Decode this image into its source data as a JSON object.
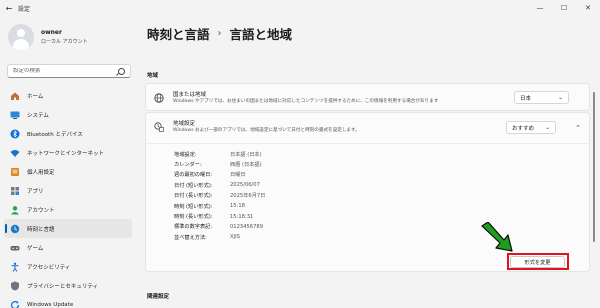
{
  "window": {
    "title": "設定"
  },
  "profile": {
    "name": "owner",
    "account_type": "ローカル アカウント"
  },
  "search": {
    "placeholder": "設定の検索"
  },
  "sidebar": {
    "items": [
      {
        "label": "ホーム",
        "icon": "home-icon"
      },
      {
        "label": "システム",
        "icon": "monitor-icon"
      },
      {
        "label": "Bluetooth とデバイス",
        "icon": "bluetooth-icon"
      },
      {
        "label": "ネットワークとインターネット",
        "icon": "wifi-icon"
      },
      {
        "label": "個人用設定",
        "icon": "brush-icon"
      },
      {
        "label": "アプリ",
        "icon": "apps-icon"
      },
      {
        "label": "アカウント",
        "icon": "person-icon"
      },
      {
        "label": "時刻と言語",
        "icon": "clock-globe-icon",
        "active": true
      },
      {
        "label": "ゲーム",
        "icon": "gamepad-icon"
      },
      {
        "label": "アクセシビリティ",
        "icon": "accessibility-icon"
      },
      {
        "label": "プライバシーとセキュリティ",
        "icon": "shield-icon"
      },
      {
        "label": "Windows Update",
        "icon": "update-icon"
      }
    ]
  },
  "breadcrumb": {
    "parent": "時刻と言語",
    "separator": "›",
    "current": "言語と地域"
  },
  "region": {
    "section_title": "地域",
    "country": {
      "title": "国または地域",
      "description": "Windows やアプリでは、お住まいの国または地域に対応したコンテンツを提供するために、この情報を利用する場合があります",
      "value": "日本"
    },
    "format": {
      "title": "地域設定",
      "description": "Windows および一部のアプリでは、地域設定に基づいて日付と時刻の書式を設定します。",
      "value": "おすすめ",
      "rows": [
        {
          "label": "地域設定:",
          "value": "日本語 (日本)"
        },
        {
          "label": "カレンダー:",
          "value": "西暦 (日本語)"
        },
        {
          "label": "週の最初の曜日:",
          "value": "日曜日"
        },
        {
          "label": "日付 (短い形式):",
          "value": "2025/06/07"
        },
        {
          "label": "日付 (長い形式):",
          "value": "2025年6月7日"
        },
        {
          "label": "時刻 (短い形式):",
          "value": "15:18"
        },
        {
          "label": "時刻 (長い形式):",
          "value": "15:18:31"
        },
        {
          "label": "標準の数字表記:",
          "value": "0123456789"
        },
        {
          "label": "並べ替え方法:",
          "value": "XJIS"
        }
      ],
      "change_button": "形式を変更"
    }
  },
  "related": {
    "title": "関連設定"
  },
  "colors": {
    "accent": "#005fb8",
    "highlight": "#e0141e",
    "arrow": "#1e9e1e"
  }
}
